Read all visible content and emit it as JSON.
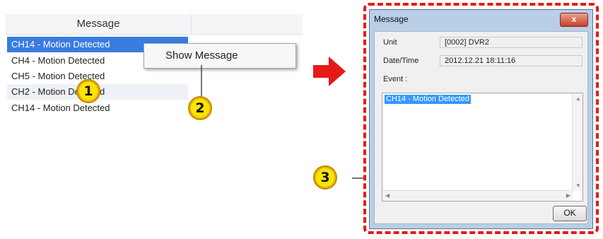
{
  "list": {
    "header": "Message",
    "rows": [
      "CH14 - Motion Detected",
      "CH4 - Motion Detected",
      "CH5 - Motion Detected",
      "CH2 - Motion Detected",
      "CH14 - Motion Detected"
    ]
  },
  "context_menu": {
    "show_message": "Show Message"
  },
  "callouts": {
    "one": "1",
    "two": "2",
    "three": "3"
  },
  "dialog": {
    "title": "Message",
    "close_label": "x",
    "unit_label": "Unit",
    "unit_value": "[0002] DVR2",
    "datetime_label": "Date/Time",
    "datetime_value": "2012.12.21 18:11:16",
    "event_label": "Event :",
    "event_text": "CH14 - Motion Detected",
    "ok_label": "OK"
  },
  "colors": {
    "accent": "#e41b17",
    "selection": "#3a7ce0",
    "badge": "#ffe400"
  },
  "icons": {
    "arrow": "right-arrow-icon",
    "close": "close-icon"
  }
}
